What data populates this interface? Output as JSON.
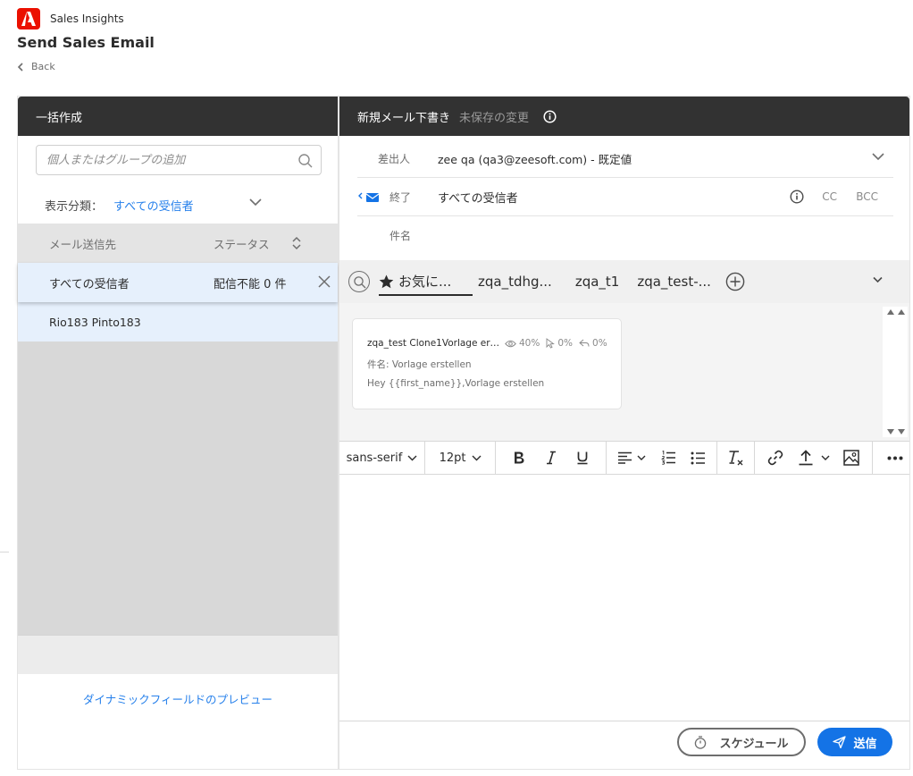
{
  "header": {
    "app_name": "Sales Insights",
    "page_title": "Send Sales Email",
    "back_label": "Back"
  },
  "left": {
    "panel_title": "一括作成",
    "add_placeholder": "個人またはグループの追加",
    "filter_label": "表示分類：",
    "filter_value": "すべての受信者",
    "col_recipient": "メール送信先",
    "col_status": "ステータス",
    "rows": [
      {
        "recipient": "すべての受信者",
        "status": "配信不能 0 件"
      },
      {
        "recipient": "Rio183 Pinto183",
        "status": ""
      }
    ],
    "dynamic_preview_link": "ダイナミックフィールドのプレビュー"
  },
  "draft": {
    "title": "新規メール下書き",
    "unsaved": "未保存の変更",
    "from_label": "差出人",
    "from_value": "zee qa (qa3@zeesoft.com) - 既定値",
    "to_label": "終了",
    "to_value": "すべての受信者",
    "cc_label": "CC",
    "bcc_label": "BCC",
    "subject_label": "件名"
  },
  "templates": {
    "tabs": [
      "お気に...",
      "zqa_tdhg...",
      "zqa_t1",
      "zqa_test-..."
    ],
    "card": {
      "name": "zqa_test Clone1Vorlage erst...",
      "open_rate": "40%",
      "click_rate": "0%",
      "reply_rate": "0%",
      "subject": "件名: Vorlage erstellen",
      "body": "Hey {{first_name}},Vorlage erstellen"
    }
  },
  "toolbar": {
    "font": "sans-serif",
    "size": "12pt"
  },
  "actions": {
    "schedule_label": "スケジュール",
    "send_label": "送信"
  },
  "colors": {
    "accent": "#1473e6",
    "link": "#2680eb",
    "header_bg": "#323232",
    "brand": "#eb1000"
  }
}
